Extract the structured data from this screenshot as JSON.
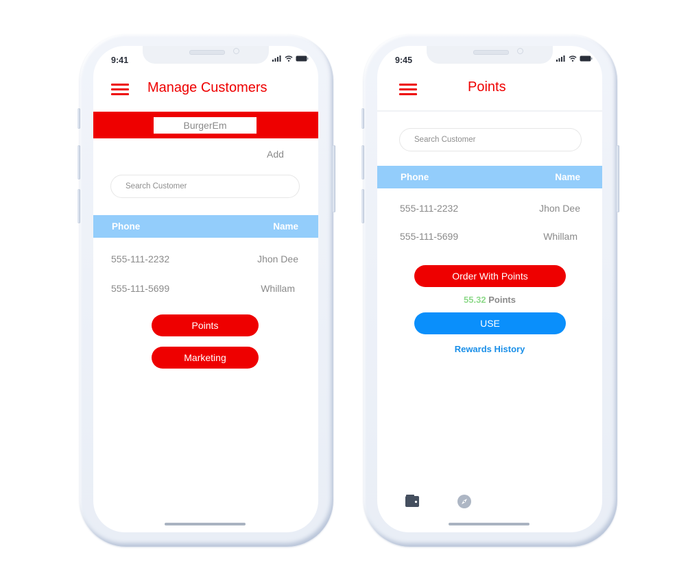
{
  "colors": {
    "brand_red": "#ee0000",
    "table_header_blue": "#93cdfb",
    "use_button_blue": "#0a8ffb",
    "points_value_green": "#8ed98a",
    "link_blue": "#1a8fe8"
  },
  "screen1": {
    "status_time": "9:41",
    "title": "Manage Customers",
    "store_name": "BurgerEm",
    "add_label": "Add",
    "search_placeholder": "Search Customer",
    "table": {
      "headers": [
        "Phone",
        "Name"
      ],
      "rows": [
        {
          "phone": "555-111-2232",
          "name": "Jhon Dee"
        },
        {
          "phone": "555-111-5699",
          "name": "Whillam"
        }
      ]
    },
    "buttons": {
      "points": "Points",
      "marketing": "Marketing"
    }
  },
  "screen2": {
    "status_time": "9:45",
    "title": "Points",
    "search_placeholder": "Search Customer",
    "table": {
      "headers": [
        "Phone",
        "Name"
      ],
      "rows": [
        {
          "phone": "555-111-2232",
          "name": "Jhon Dee"
        },
        {
          "phone": "555-111-5699",
          "name": "Whillam"
        }
      ]
    },
    "order_button": "Order With Points",
    "points_value": "55.32",
    "points_unit": "Points",
    "use_button": "USE",
    "rewards_link": "Rewards History",
    "tabbar": [
      {
        "icon": "wallet-icon",
        "active": true
      },
      {
        "icon": "compass-icon",
        "active": false
      }
    ]
  }
}
